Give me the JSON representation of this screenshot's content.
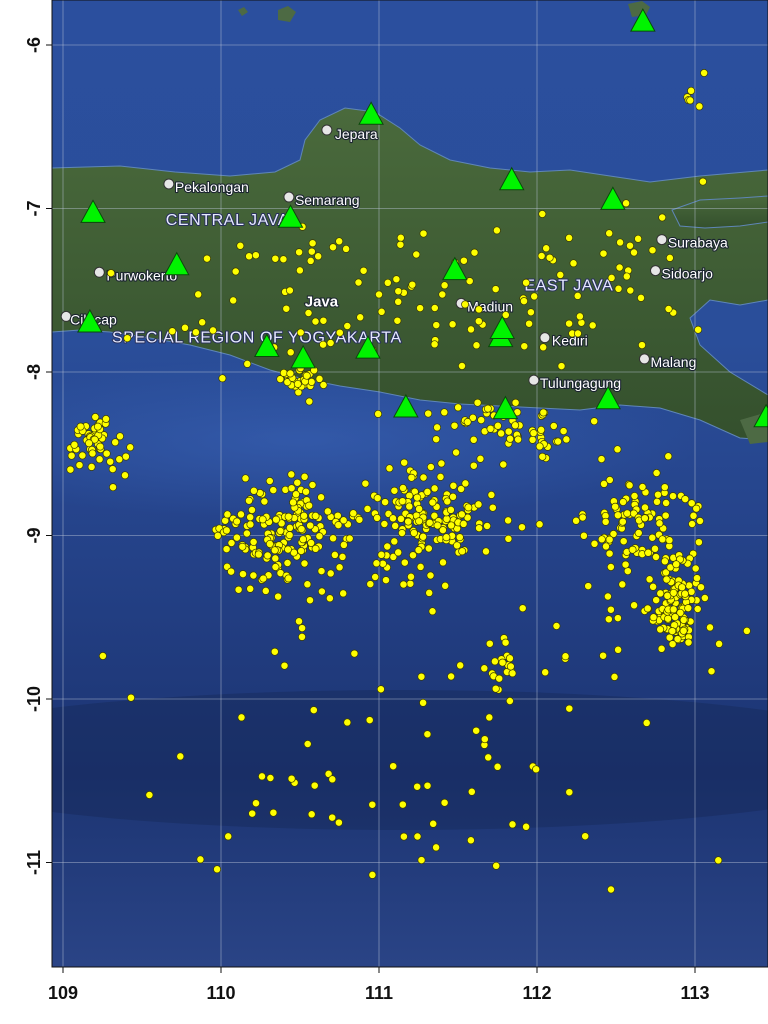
{
  "map": {
    "x_ticks": [
      "109",
      "110",
      "111",
      "112",
      "113"
    ],
    "y_ticks": [
      "-6",
      "-7",
      "-8",
      "-9",
      "-10",
      "-11"
    ],
    "lon_range": [
      108.97,
      113.45
    ],
    "lat_range": [
      -11.65,
      -5.7
    ],
    "regions": [
      {
        "name": "CENTRAL JAVA",
        "lon": 109.65,
        "lat": -7.1
      },
      {
        "name": "EAST JAVA",
        "lon": 111.92,
        "lat": -7.5
      },
      {
        "name": "SPECIAL REGION OF YOGYAKARTA",
        "lon": 109.31,
        "lat": -7.82
      },
      {
        "name": "Java",
        "lon": 110.53,
        "lat": -7.6
      }
    ],
    "cities": [
      {
        "name": "Jepara",
        "lon": 110.67,
        "lat": -6.52,
        "label_dx": 8,
        "label_dy": 9
      },
      {
        "name": "Pekalongan",
        "lon": 109.67,
        "lat": -6.85,
        "label_dx": 6,
        "label_dy": 8
      },
      {
        "name": "Semarang",
        "lon": 110.43,
        "lat": -6.93,
        "label_dx": 6,
        "label_dy": 8
      },
      {
        "name": "Purwokerto",
        "lon": 109.23,
        "lat": -7.39,
        "label_dx": 7,
        "label_dy": 8
      },
      {
        "name": "Cilacap",
        "lon": 109.02,
        "lat": -7.66,
        "label_dx": 4,
        "label_dy": 8
      },
      {
        "name": "Madiun",
        "lon": 111.52,
        "lat": -7.58,
        "label_dx": 6,
        "label_dy": 8
      },
      {
        "name": "Kediri",
        "lon": 112.05,
        "lat": -7.79,
        "label_dx": 7,
        "label_dy": 8
      },
      {
        "name": "Tulungagung",
        "lon": 111.98,
        "lat": -8.05,
        "label_dx": 6,
        "label_dy": 8
      },
      {
        "name": "Surabaya",
        "lon": 112.79,
        "lat": -7.19,
        "label_dx": 6,
        "label_dy": 8
      },
      {
        "name": "Sidoarjo",
        "lon": 112.75,
        "lat": -7.38,
        "label_dx": 6,
        "label_dy": 8
      },
      {
        "name": "Malang",
        "lon": 112.68,
        "lat": -7.92,
        "label_dx": 6,
        "label_dy": 8
      }
    ],
    "stations": [
      {
        "lon": 112.67,
        "lat": -5.86
      },
      {
        "lon": 110.95,
        "lat": -6.43
      },
      {
        "lon": 109.19,
        "lat": -7.03
      },
      {
        "lon": 110.44,
        "lat": -7.06
      },
      {
        "lon": 111.84,
        "lat": -6.83
      },
      {
        "lon": 112.48,
        "lat": -6.95
      },
      {
        "lon": 109.72,
        "lat": -7.35
      },
      {
        "lon": 111.48,
        "lat": -7.38
      },
      {
        "lon": 109.17,
        "lat": -7.7
      },
      {
        "lon": 110.29,
        "lat": -7.85
      },
      {
        "lon": 110.52,
        "lat": -7.92
      },
      {
        "lon": 110.93,
        "lat": -7.86
      },
      {
        "lon": 111.77,
        "lat": -7.79
      },
      {
        "lon": 111.78,
        "lat": -7.74
      },
      {
        "lon": 111.17,
        "lat": -8.22
      },
      {
        "lon": 111.8,
        "lat": -8.23
      },
      {
        "lon": 112.45,
        "lat": -8.17
      },
      {
        "lon": 113.45,
        "lat": -8.28
      }
    ],
    "colors": {
      "sea": "#1d3a86",
      "land": "#3d5a34",
      "station": "#00f400",
      "earthquake": "#ffff00",
      "city": "#e6e6e6"
    }
  }
}
